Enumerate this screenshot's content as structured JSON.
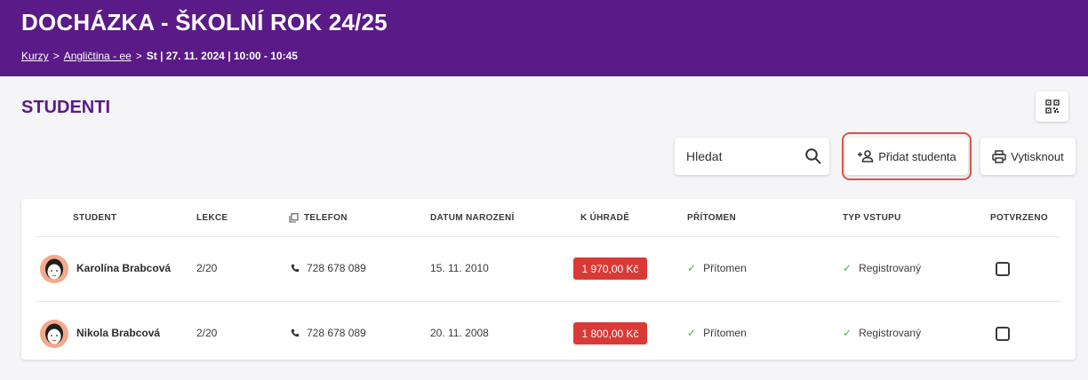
{
  "header": {
    "title": "DOCHÁZKA - ŠKOLNÍ ROK 24/25",
    "breadcrumb": {
      "items": [
        "Kurzy",
        "Angličtina - ee"
      ],
      "separator": ">",
      "current": "St | 27. 11. 2024 | 10:00 - 10:45"
    },
    "background_color": "#5a1a87"
  },
  "section": {
    "title": "STUDENTI"
  },
  "toolbar": {
    "qr_icon": "qr-code-icon",
    "search": {
      "placeholder": "Hledat",
      "value": "",
      "icon": "search-icon"
    },
    "add_student_label": "Přidat studenta",
    "add_student_icon": "person-add-icon",
    "print_label": "Vytisknout",
    "print_icon": "printer-icon",
    "highlight_color": "#d9534a"
  },
  "table": {
    "columns": {
      "student": "STUDENT",
      "lessons": "LEKCE",
      "phone": "TELEFON",
      "birth_date": "DATUM NAROZENÍ",
      "due": "K ÚHRADĚ",
      "present": "PŘÍTOMEN",
      "entry_type": "TYP VSTUPU",
      "confirmed": "POTVRZENO"
    },
    "phone_header_icon": "copy-icon",
    "rows": [
      {
        "name": "Karolína Brabcová",
        "lessons": "2/20",
        "phone": "728 678 089",
        "birth_date": "15. 11. 2010",
        "due": "1 970,00 Kč",
        "present": "Přítomen",
        "entry_type": "Registrovaný",
        "confirmed": false
      },
      {
        "name": "Nikola Brabcová",
        "lessons": "2/20",
        "phone": "728 678 089",
        "birth_date": "20. 11. 2008",
        "due": "1 800,00 Kč",
        "present": "Přítomen",
        "entry_type": "Registrovaný",
        "confirmed": false
      }
    ],
    "due_color": "#d93a36",
    "check_color": "#4caf50"
  }
}
